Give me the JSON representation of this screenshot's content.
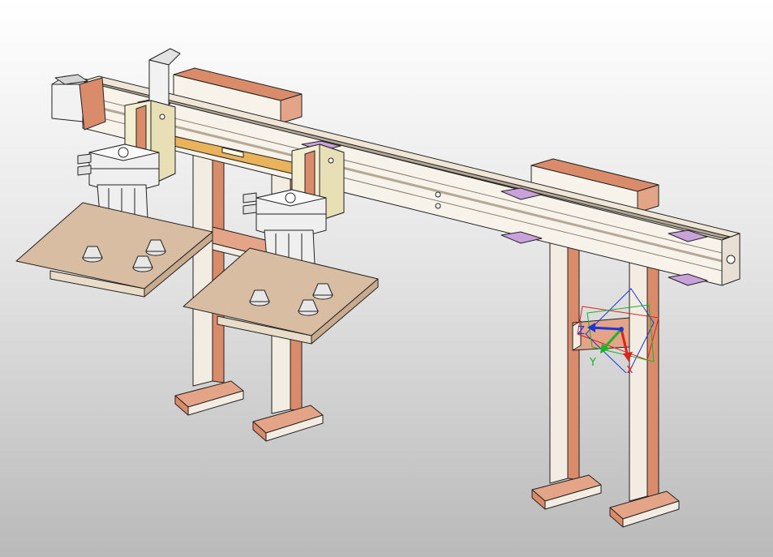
{
  "window": {
    "title": ""
  },
  "viewport": {
    "background_top": "#ffffff",
    "background_bottom": "#b9b9b9",
    "model_colors": {
      "leg": "#f2ece2",
      "leg_trim": "#d98b6a",
      "beam": "#f7f2ea",
      "belt": "#b5a896",
      "cardboard": "#d8bda3",
      "suction_plate": "#48c36a",
      "slider_block": "#c9a2dc",
      "outline": "#222222"
    }
  },
  "triad": {
    "x_label": "X",
    "y_label": "Y",
    "z_label": "Z",
    "x_color": "#e0201a",
    "y_color": "#1fb22a",
    "z_color": "#1d36d6"
  }
}
